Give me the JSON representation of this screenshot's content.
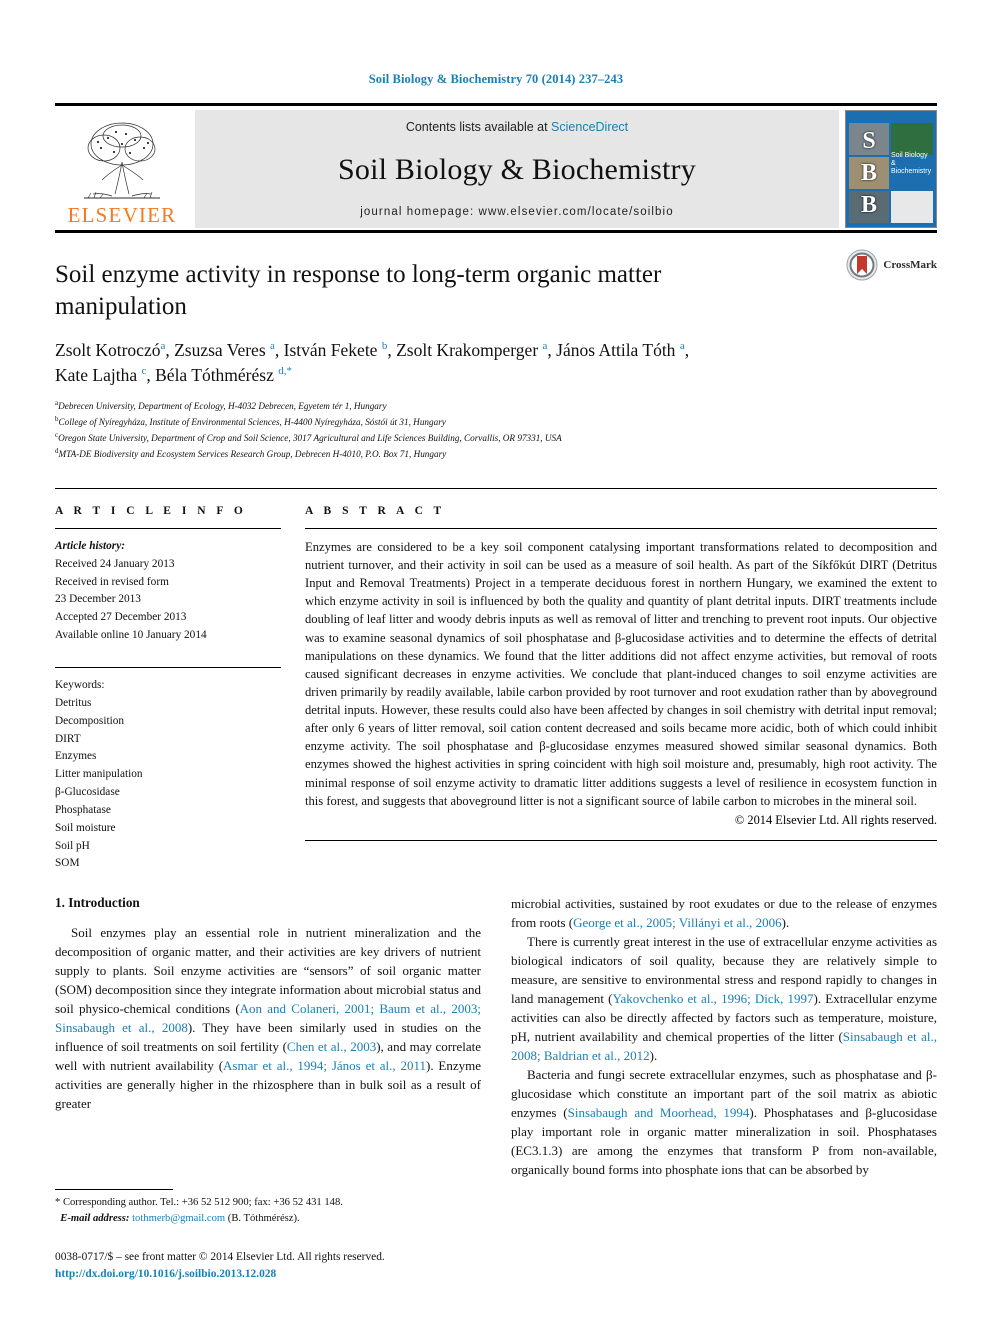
{
  "running_head": "Soil Biology & Biochemistry 70 (2014) 237–243",
  "masthead": {
    "publisher": "ELSEVIER",
    "contents_prefix": "Contents lists available at ",
    "sciencedirect": "ScienceDirect",
    "journal_name": "Soil Biology & Biochemistry",
    "homepage": "journal homepage: www.elsevier.com/locate/soilbio",
    "cover_letters": [
      "S",
      "B",
      "B"
    ],
    "cover_title": "Soil Biology & Biochemistry",
    "accent_color": "#1a7fb5",
    "elsevier_orange": "#F47920"
  },
  "article": {
    "title": "Soil enzyme activity in response to long-term organic matter manipulation",
    "crossmark_label": "CrossMark",
    "authors_line_1": "Zsolt Kotroczó a, Zsuzsa Veres a, István Fekete b, Zsolt Krakomperger a, János Attila Tóth a,",
    "authors_line_2": "Kate Lajtha c, Béla Tóthmérész d,*",
    "affiliations": [
      {
        "marker": "a",
        "text": "Debrecen University, Department of Ecology, H-4032 Debrecen, Egyetem tér 1, Hungary"
      },
      {
        "marker": "b",
        "text": "College of Nyíregyháza, Institute of Environmental Sciences, H-4400 Nyíregyháza, Sóstói út 31, Hungary"
      },
      {
        "marker": "c",
        "text": "Oregon State University, Department of Crop and Soil Science, 3017 Agricultural and Life Sciences Building, Corvallis, OR 97331, USA"
      },
      {
        "marker": "d",
        "text": "MTA-DE Biodiversity and Ecosystem Services Research Group, Debrecen H-4010, P.O. Box 71, Hungary"
      }
    ]
  },
  "article_info": {
    "heading": "A R T I C L E    I N F O",
    "history_label": "Article history:",
    "history": [
      "Received 24 January 2013",
      "Received in revised form",
      "23 December 2013",
      "Accepted 27 December 2013",
      "Available online 10 January 2014"
    ],
    "keywords_label": "Keywords:",
    "keywords": [
      "Detritus",
      "Decomposition",
      "DIRT",
      "Enzymes",
      "Litter manipulation",
      "β-Glucosidase",
      "Phosphatase",
      "Soil moisture",
      "Soil pH",
      "SOM"
    ]
  },
  "abstract": {
    "heading": "A B S T R A C T",
    "text": "Enzymes are considered to be a key soil component catalysing important transformations related to decomposition and nutrient turnover, and their activity in soil can be used as a measure of soil health. As part of the Síkfőkút DIRT (Detritus Input and Removal Treatments) Project in a temperate deciduous forest in northern Hungary, we examined the extent to which enzyme activity in soil is influenced by both the quality and quantity of plant detrital inputs. DIRT treatments include doubling of leaf litter and woody debris inputs as well as removal of litter and trenching to prevent root inputs. Our objective was to examine seasonal dynamics of soil phosphatase and β-glucosidase activities and to determine the effects of detrital manipulations on these dynamics. We found that the litter additions did not affect enzyme activities, but removal of roots caused significant decreases in enzyme activities. We conclude that plant-induced changes to soil enzyme activities are driven primarily by readily available, labile carbon provided by root turnover and root exudation rather than by aboveground detrital inputs. However, these results could also have been affected by changes in soil chemistry with detrital input removal; after only 6 years of litter removal, soil cation content decreased and soils became more acidic, both of which could inhibit enzyme activity. The soil phosphatase and β-glucosidase enzymes measured showed similar seasonal dynamics. Both enzymes showed the highest activities in spring coincident with high soil moisture and, presumably, high root activity. The minimal response of soil enzyme activity to dramatic litter additions suggests a level of resilience in ecosystem function in this forest, and suggests that aboveground litter is not a significant source of labile carbon to microbes in the mineral soil.",
    "copyright": "© 2014 Elsevier Ltd. All rights reserved."
  },
  "body": {
    "section_number_title": "1.  Introduction",
    "left_paragraph_1_pre": "Soil enzymes play an essential role in nutrient mineralization and the decomposition of organic matter, and their activities are key drivers of nutrient supply to plants. Soil enzyme activities are “sensors” of soil organic matter (SOM) decomposition since they integrate information about microbial status and soil physico-chemical conditions (",
    "left_cite_1": "Aon and Colaneri, 2001; Baum et al., 2003; Sinsabaugh et al., 2008",
    "left_mid_1": "). They have been similarly used in studies on the influence of soil treatments on soil fertility (",
    "left_cite_2": "Chen et al., 2003",
    "left_mid_2": "), and may correlate well with nutrient availability (",
    "left_cite_3": "Asmar et al., 1994; János et al., 2011",
    "left_end_1": "). Enzyme activities are generally higher in the rhizosphere than in bulk soil as a result of greater",
    "right_para_1_pre": "microbial activities, sustained by root exudates or due to the release of enzymes from roots (",
    "right_cite_1": "George et al., 2005; Villányi et al., 2006",
    "right_para_1_end": ").",
    "right_para_2_pre": "There is currently great interest in the use of extracellular enzyme activities as biological indicators of soil quality, because they are relatively simple to measure, are sensitive to environmental stress and respond rapidly to changes in land management (",
    "right_cite_2": "Yakovchenko et al., 1996; Dick, 1997",
    "right_para_2_mid": "). Extracellular enzyme activities can also be directly affected by factors such as temperature, moisture, pH, nutrient availability and chemical properties of the litter (",
    "right_cite_3": "Sinsabaugh et al., 2008; Baldrian et al., 2012",
    "right_para_2_end": ").",
    "right_para_3_pre": "Bacteria and fungi secrete extracellular enzymes, such as phosphatase and β-glucosidase which constitute an important part of the soil matrix as abiotic enzymes (",
    "right_cite_4": "Sinsabaugh and Moorhead, 1994",
    "right_para_3_end": "). Phosphatases and β-glucosidase play important role in organic matter mineralization in soil. Phosphatases (EC3.1.3) are among the enzymes that transform P from non-available, organically bound forms into phosphate ions that can be absorbed by"
  },
  "footnote": {
    "corresponding": "* Corresponding author. Tel.: +36 52 512 900; fax: +36 52 431 148.",
    "email_label": "E-mail address:",
    "email": "tothmerb@gmail.com",
    "email_suffix": "(B. Tóthmérész)."
  },
  "footer": {
    "issn_line": "0038-0717/$ – see front matter © 2014 Elsevier Ltd. All rights reserved.",
    "doi": "http://dx.doi.org/10.1016/j.soilbio.2013.12.028"
  }
}
